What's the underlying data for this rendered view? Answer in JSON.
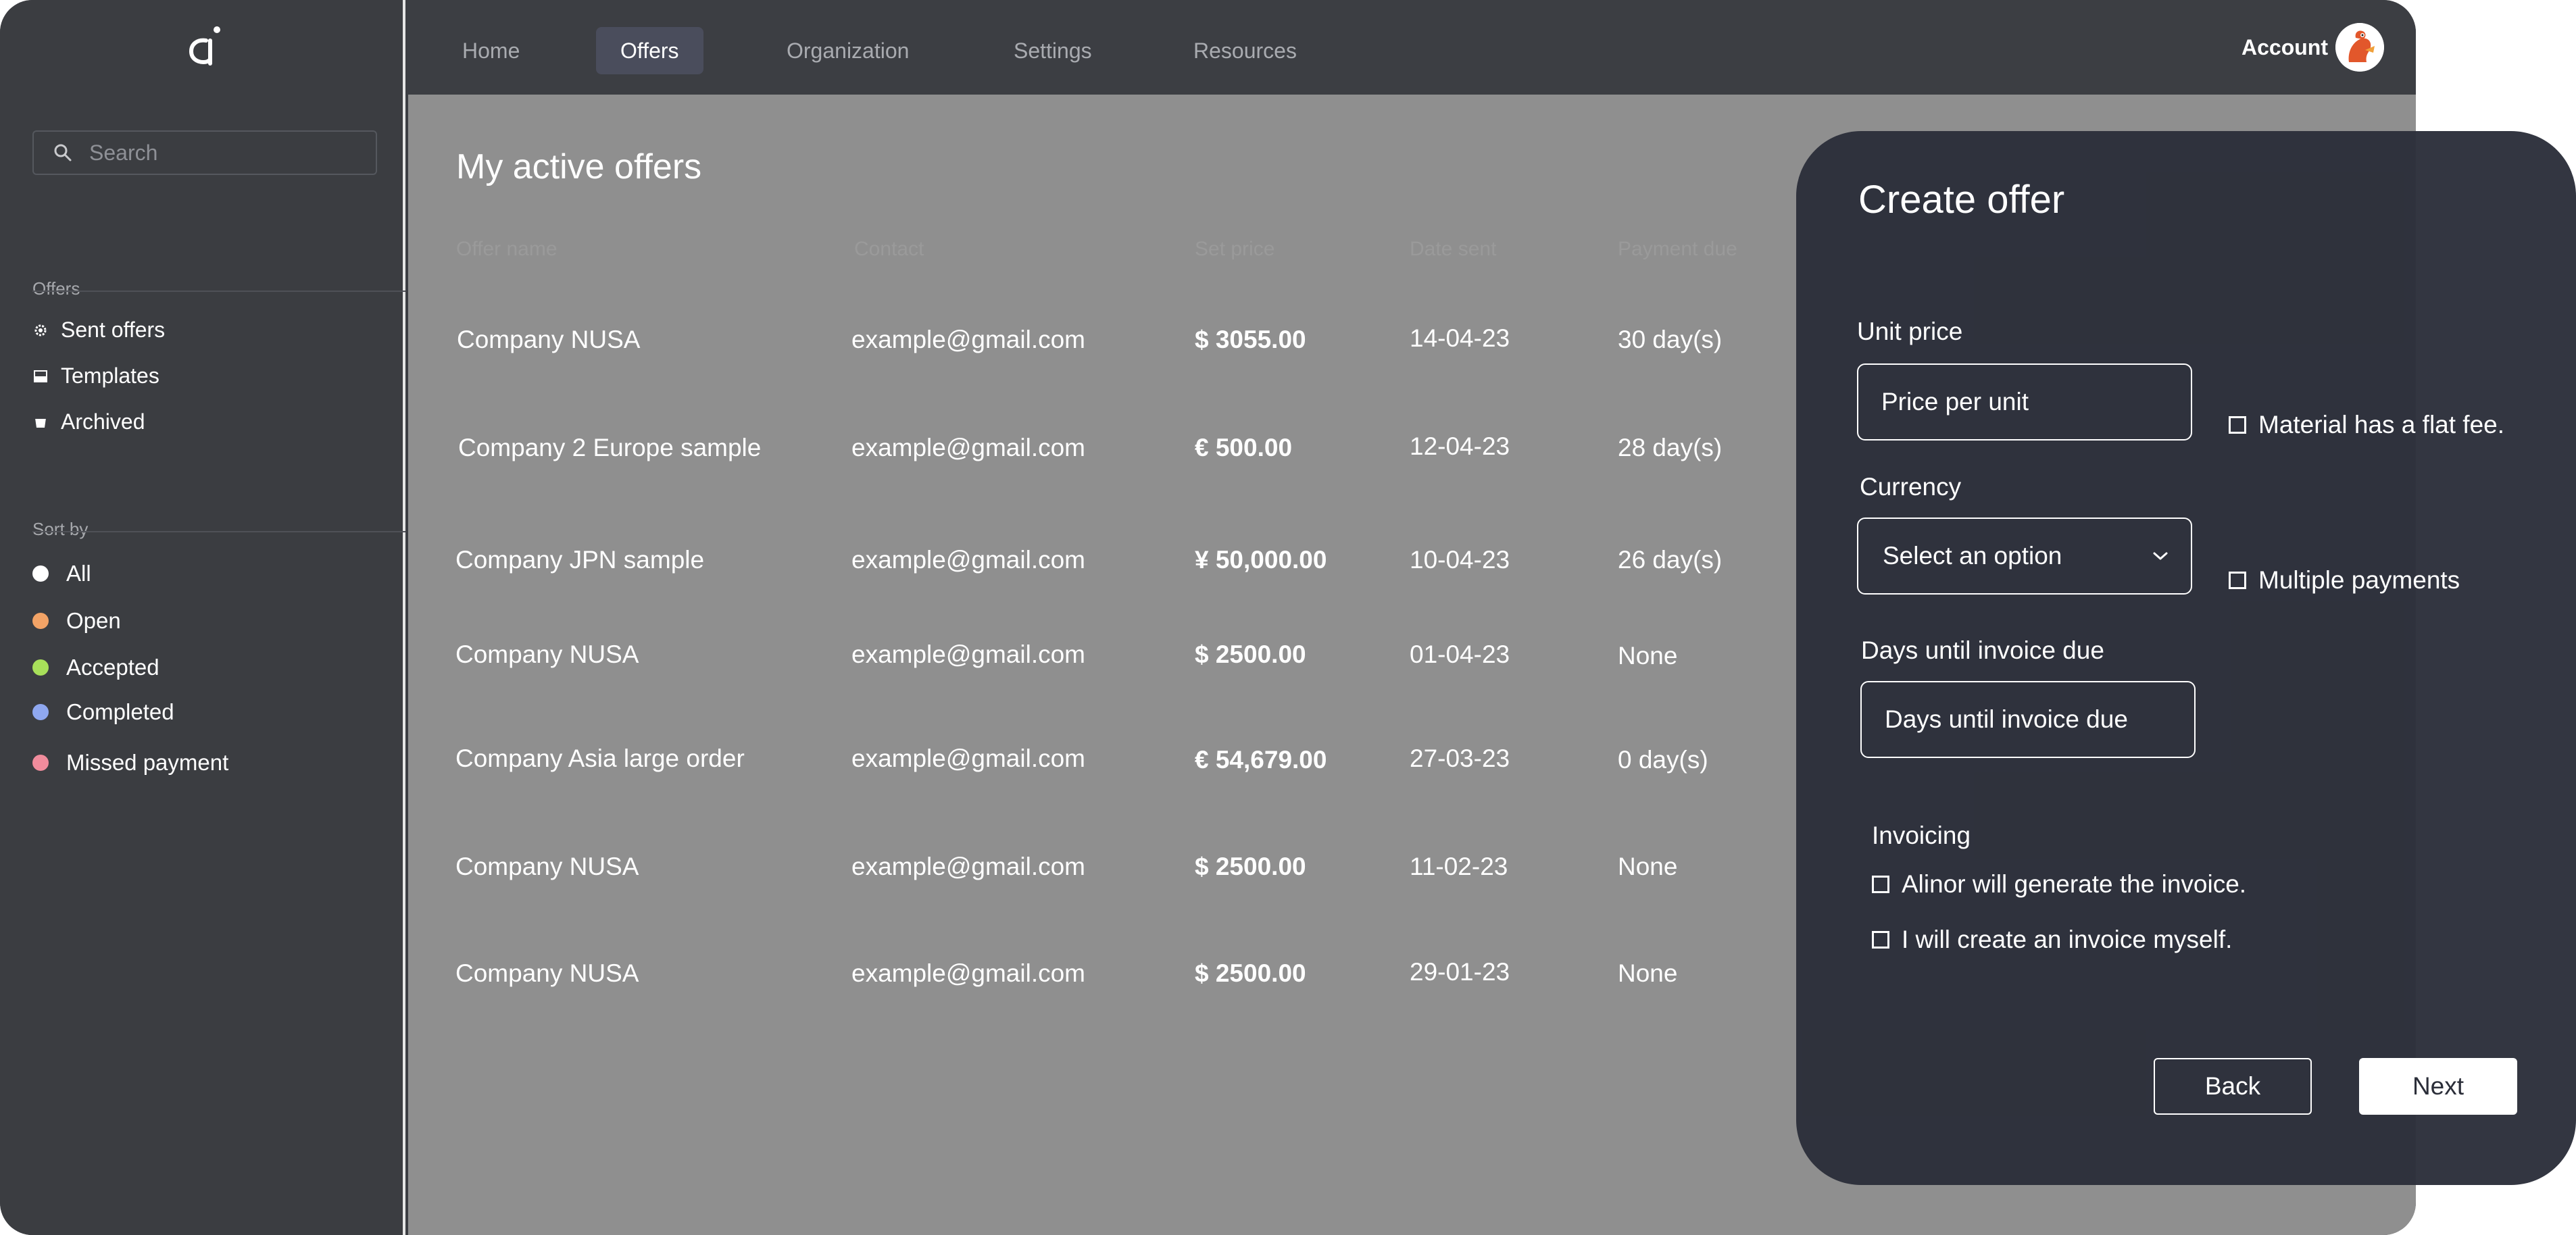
{
  "nav": {
    "tabs": [
      {
        "label": "Home"
      },
      {
        "label": "Offers"
      },
      {
        "label": "Organization"
      },
      {
        "label": "Settings"
      },
      {
        "label": "Resources"
      }
    ],
    "account_label": "Account"
  },
  "sidebar": {
    "search_placeholder": "Search",
    "offers_label": "Offers",
    "offer_items": [
      {
        "label": "Sent offers",
        "icon": "gear-icon"
      },
      {
        "label": "Templates",
        "icon": "template-icon"
      },
      {
        "label": "Archived",
        "icon": "archive-icon"
      }
    ],
    "sort_label": "Sort by",
    "sort_items": [
      {
        "label": "All",
        "color": "#ffffff"
      },
      {
        "label": "Open",
        "color": "#f2a366"
      },
      {
        "label": "Accepted",
        "color": "#a8e05a"
      },
      {
        "label": "Completed",
        "color": "#8fa8f0"
      },
      {
        "label": "Missed payment",
        "color": "#f08c9c"
      }
    ]
  },
  "main": {
    "title": "My active offers",
    "columns": [
      "Offer name",
      "Contact",
      "Set price",
      "Date sent",
      "Payment due"
    ],
    "rows": [
      {
        "name": "Company NUSA",
        "contact": "example@gmail.com",
        "price": "$ 3055.00",
        "date": "14-04-23",
        "due": "30 day(s)"
      },
      {
        "name": "Company 2 Europe sample",
        "contact": "example@gmail.com",
        "price": "€ 500.00",
        "date": "12-04-23",
        "due": "28 day(s)"
      },
      {
        "name": "Company JPN sample",
        "contact": "example@gmail.com",
        "price": "¥ 50,000.00",
        "date": "10-04-23",
        "due": "26 day(s)"
      },
      {
        "name": "Company NUSA",
        "contact": "example@gmail.com",
        "price": "$ 2500.00",
        "date": "01-04-23",
        "due": "None"
      },
      {
        "name": "Company Asia large order",
        "contact": "example@gmail.com",
        "price": "€ 54,679.00",
        "date": "27-03-23",
        "due": "0 day(s)"
      },
      {
        "name": "Company NUSA",
        "contact": "example@gmail.com",
        "price": "$ 2500.00",
        "date": "11-02-23",
        "due": "None"
      },
      {
        "name": "Company NUSA",
        "contact": "example@gmail.com",
        "price": "$ 2500.00",
        "date": "29-01-23",
        "due": "None"
      }
    ]
  },
  "create_offer": {
    "title": "Create offer",
    "unit_price_label": "Unit price",
    "unit_price_placeholder": "Price per unit",
    "flat_fee_label": "Material has a flat fee.",
    "currency_label": "Currency",
    "currency_value": "Select an option",
    "multiple_payments_label": "Multiple payments",
    "days_label": "Days until invoice due",
    "days_placeholder": "Days until invoice due",
    "invoicing_label": "Invoicing",
    "invoice_option_1": "Alinor will generate the invoice.",
    "invoice_option_2": "I will create an invoice myself.",
    "back_label": "Back",
    "next_label": "Next"
  }
}
